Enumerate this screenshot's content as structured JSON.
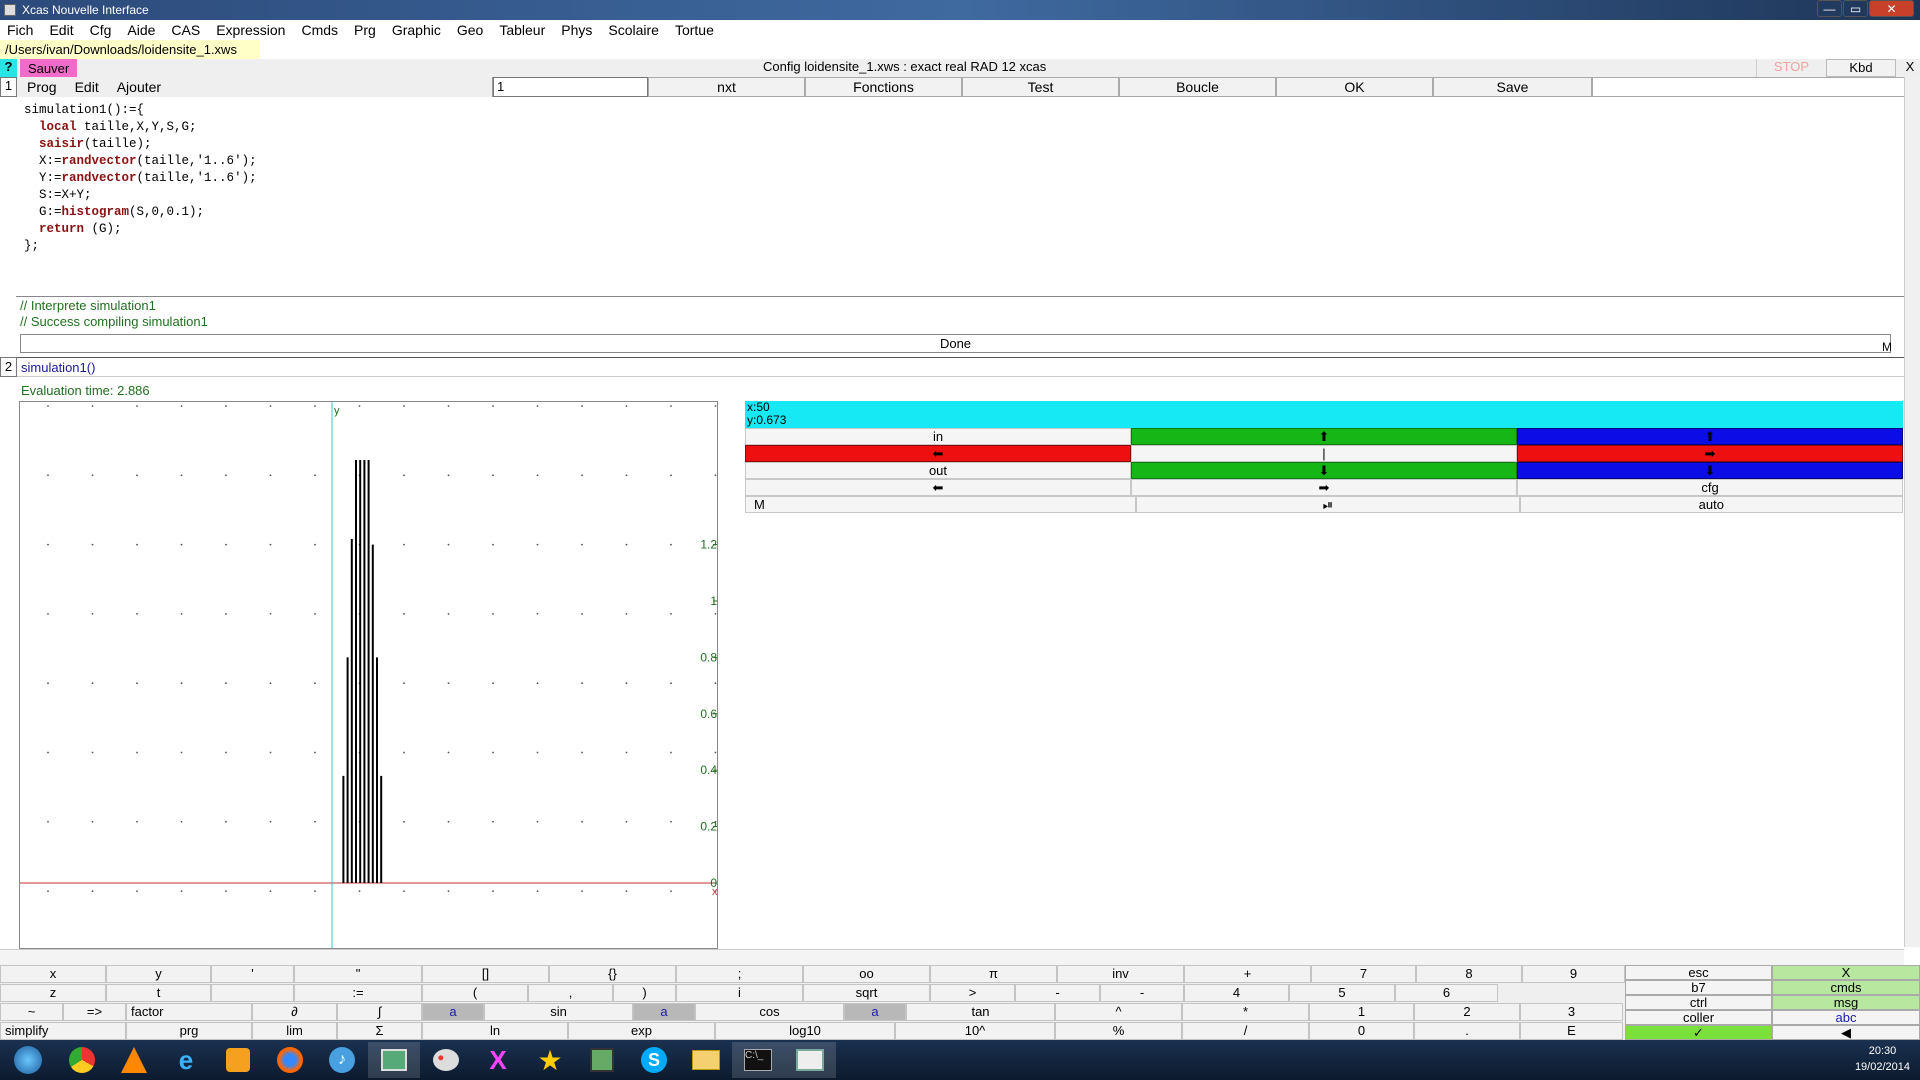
{
  "window": {
    "title": "Xcas Nouvelle Interface",
    "controls": [
      "—",
      "▭",
      "✕"
    ]
  },
  "menu": [
    "Fich",
    "Edit",
    "Cfg",
    "Aide",
    "CAS",
    "Expression",
    "Cmds",
    "Prg",
    "Graphic",
    "Geo",
    "Tableur",
    "Phys",
    "Scolaire",
    "Tortue"
  ],
  "path": "/Users/ivan/Downloads/loidensite_1.xws",
  "status": {
    "help": "?",
    "save": "Sauver",
    "config": "Config loidensite_1.xws : exact real RAD 12 xcas",
    "stop": "STOP",
    "kbd": "Kbd",
    "close": "X"
  },
  "toolbar": {
    "level": "1",
    "menus": [
      "Prog",
      "Edit",
      "Ajouter"
    ],
    "input": "1",
    "buttons": [
      "nxt",
      "Fonctions",
      "Test",
      "Boucle",
      "OK",
      "Save"
    ]
  },
  "program": {
    "lines": [
      {
        "kw": "",
        "text": "simulation1():={"
      },
      {
        "kw": "local",
        "text": " taille,X,Y,S,G;"
      },
      {
        "kw": "saisir",
        "text": "(taille);"
      },
      {
        "kw": "",
        "text": "X:=",
        "kw2": "randvector",
        "text2": "(taille,'1..6');"
      },
      {
        "kw": "",
        "text": "Y:=",
        "kw2": "randvector",
        "text2": "(taille,'1..6');"
      },
      {
        "kw": "",
        "text": "S:=X+Y;"
      },
      {
        "kw": "",
        "text": "G:=",
        "kw2": "histogram",
        "text2": "(S,0,0.1);"
      },
      {
        "kw": "return",
        "text": " (G);"
      },
      {
        "kw": "",
        "text": "};"
      }
    ]
  },
  "output": {
    "line1": "// Interprete simulation1",
    "line2": "// Success compiling simulation1",
    "done": "Done",
    "m": "M"
  },
  "entry2": {
    "level": "2",
    "command": "simulation1()",
    "eval": "Evaluation time: 2.886"
  },
  "graph": {
    "ylabel": "y",
    "xlabel": "x",
    "yticks": [
      "1.2",
      "1",
      "0.8",
      "0.6",
      "0.4",
      "0.2",
      "0"
    ]
  },
  "chart_data": {
    "type": "bar",
    "x": [
      2,
      3,
      4,
      5,
      6,
      7,
      8,
      9,
      10,
      11,
      12
    ],
    "values": [
      0.38,
      0.8,
      1.22,
      1.5,
      1.5,
      1.5,
      1.5,
      1.2,
      0.8,
      0.38,
      0
    ],
    "ylim": [
      -0.2,
      1.4
    ],
    "grid": true
  },
  "controls": {
    "coord_x": "x:50",
    "coord_y": "y:0.673",
    "in": "in",
    "out": "out",
    "cfg": "cfg",
    "m": "M",
    "auto": "auto"
  },
  "keypad": {
    "row1": [
      "x",
      "y",
      "'",
      "\"",
      "[]",
      "{}",
      ";",
      "oo",
      "π",
      "inv",
      "+",
      "7",
      "8",
      "9"
    ],
    "row2": [
      "z",
      "t",
      "",
      ":=",
      "(",
      ",",
      ")",
      "i",
      "sqrt",
      ">",
      "-",
      "-",
      "4",
      "5",
      "6"
    ],
    "row3": [
      "~",
      "=>",
      "factor",
      "∂",
      "∫",
      "a",
      "sin",
      "a",
      "cos",
      "a",
      "tan",
      "^",
      "*",
      "1",
      "2",
      "3"
    ],
    "row4": [
      "simplify",
      "prg",
      "lim",
      "Σ",
      "ln",
      "exp",
      "log10",
      "10^",
      "%",
      "/",
      "0",
      ".",
      "E"
    ],
    "right": [
      "esc",
      "X",
      "b7",
      "cmds",
      "ctrl",
      "msg",
      "coller",
      "abc",
      "✓",
      "◀"
    ]
  },
  "taskbar": {
    "time": "20:30",
    "date": "19/02/2014"
  }
}
